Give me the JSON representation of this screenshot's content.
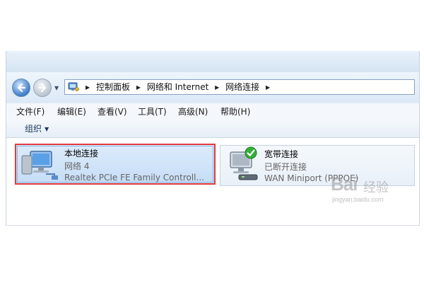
{
  "navigation": {
    "breadcrumbs": [
      "控制面板",
      "网络和 Internet",
      "网络连接"
    ]
  },
  "menu": {
    "items": [
      "文件(F)",
      "编辑(E)",
      "查看(V)",
      "工具(T)",
      "高级(N)",
      "帮助(H)"
    ]
  },
  "toolbar": {
    "organize_label": "组织"
  },
  "connections": [
    {
      "name": "本地连接",
      "status": "网络  4",
      "device": "Realtek PCIe FE Family Controll...",
      "selected": true,
      "highlight_color": "#e03a3a"
    },
    {
      "name": "宽带连接",
      "status": "已断开连接",
      "device": "WAN Miniport (PPPOE)",
      "selected": false
    }
  ],
  "icons": {
    "back": "back-arrow-icon",
    "forward": "forward-arrow-icon",
    "address": "control-panel-icon",
    "local_connection": "network-computer-icon",
    "broadband_connection": "broadband-modem-icon",
    "check_badge": "check-badge-icon"
  },
  "watermark": {
    "brand": "Bai",
    "suffix": "经验",
    "url": "jingyan.baidu.com"
  },
  "colors": {
    "accent": "#3d7dc8",
    "selection_border": "#e03a3a",
    "selection_fill": "#cfe3f8"
  }
}
